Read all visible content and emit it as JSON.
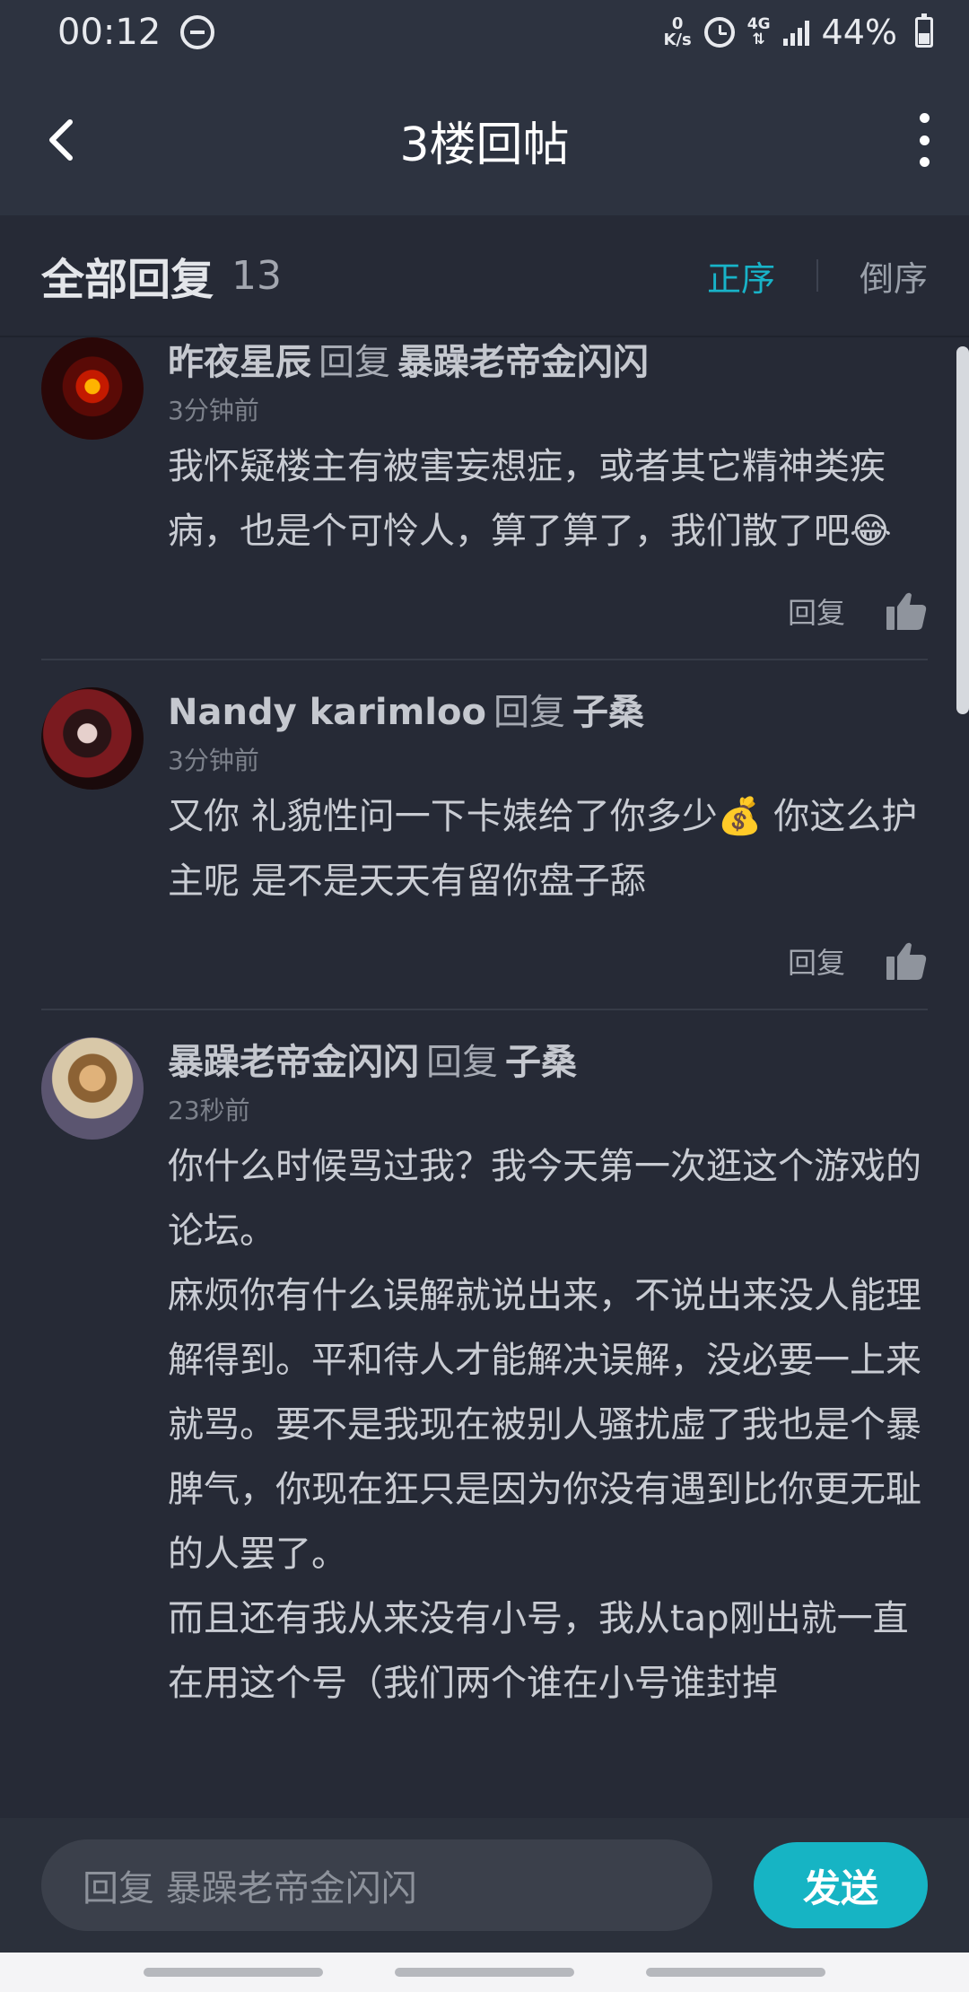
{
  "status_bar": {
    "time": "00:12",
    "speed_value": "0",
    "speed_unit": "K/s",
    "network": "4G",
    "battery": "44%"
  },
  "header": {
    "title": "3楼回帖"
  },
  "section": {
    "title": "全部回复",
    "count": "13",
    "sort_asc": "正序",
    "sort_desc": "倒序"
  },
  "comments": [
    {
      "author": "昨夜星辰",
      "reply_word": "回复",
      "target": "暴躁老帝金闪闪",
      "time": "3分钟前",
      "paragraphs": [
        "我怀疑楼主有被害妄想症，或者其它精神类疾病，也是个可怜人，算了算了，我们散了吧"
      ],
      "emoji": "😂",
      "reply_label": "回复"
    },
    {
      "author": "Nandy karimloo",
      "reply_word": "回复",
      "target": "子桑",
      "time": "3分钟前",
      "content_before": "又你 礼貌性问一下卡婊给了你多少",
      "emoji": "💰",
      "content_after": " 你这么护主呢 是不是天天有留你盘子舔",
      "reply_label": "回复"
    },
    {
      "author": "暴躁老帝金闪闪",
      "reply_word": "回复",
      "target": "子桑",
      "time": "23秒前",
      "paragraphs": [
        "你什么时候骂过我？我今天第一次逛这个游戏的论坛。",
        "麻烦你有什么误解就说出来，不说出来没人能理解得到。平和待人才能解决误解，没必要一上来就骂。要不是我现在被别人骚扰虚了我也是个暴脾气，你现在狂只是因为你没有遇到比你更无耻的人罢了。",
        "而且还有我从来没有小号，我从tap刚出就一直在用这个号（我们两个谁在小号谁封掉"
      ]
    }
  ],
  "reply_bar": {
    "placeholder": "回复 暴躁老帝金闪闪",
    "send_label": "发送"
  },
  "colors": {
    "accent": "#18b3c8",
    "background": "#262a36",
    "header_bg": "#2d3340"
  },
  "icons": [
    "back-arrow-icon",
    "more-vertical-icon",
    "thumbs-up-icon",
    "do-not-disturb-icon",
    "alarm-icon",
    "signal-icon",
    "battery-icon"
  ]
}
